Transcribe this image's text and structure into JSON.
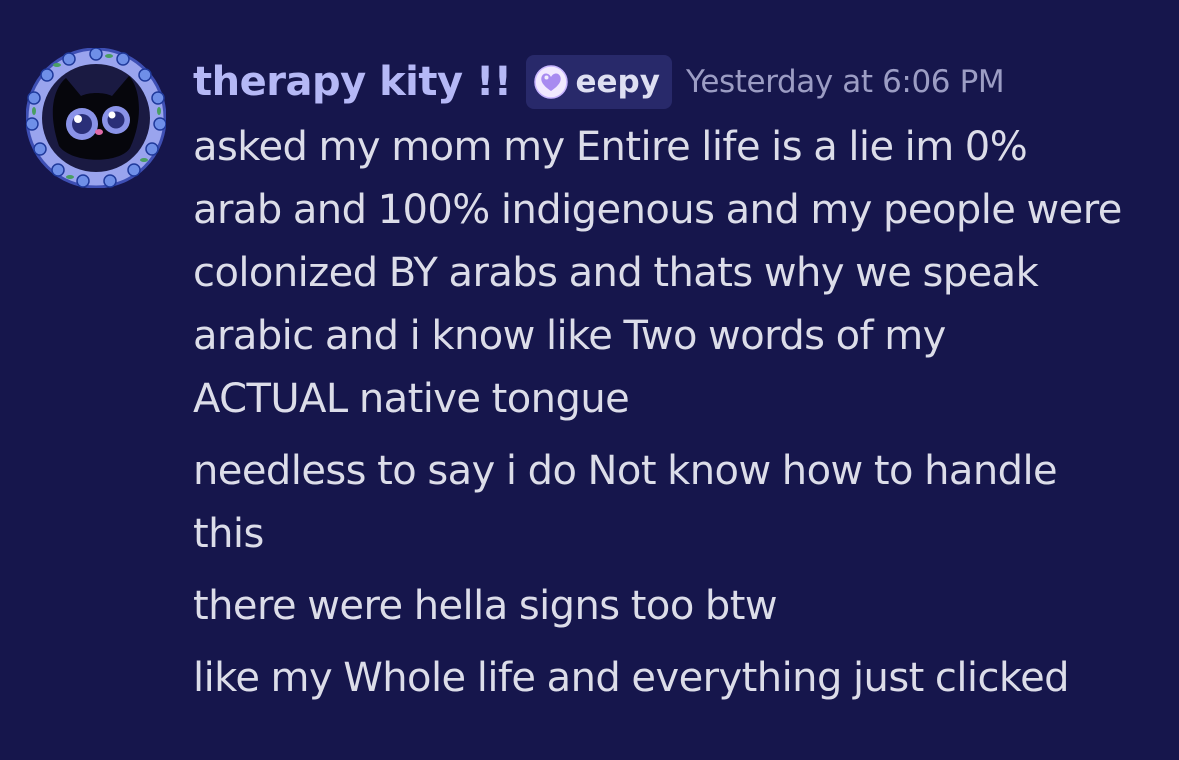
{
  "message": {
    "author": "therapy kity !!",
    "tag": {
      "label": "eepy",
      "icon": "purple-heart-icon"
    },
    "timestamp": "Yesterday at 6:06 PM",
    "avatar_icon": "black-cat-flower-wreath-avatar",
    "lines": [
      "asked my mom my Entire life is a lie im 0%\narab and 100% indigenous and my people were\ncolonized BY arabs and thats why we speak\narabic and i know like Two words of my\nACTUAL native tongue",
      "needless to say i do Not know how to handle\nthis",
      "there were hella signs too btw",
      "like my Whole life and everything just clicked"
    ]
  },
  "colors": {
    "background": "#16164c",
    "username": "#b5b8f6",
    "tag_background": "#28296a",
    "tag_text": "#dedff2",
    "timestamp": "#9c9dc4",
    "message_text": "#dcdde9",
    "heart": "#a88bf0"
  }
}
